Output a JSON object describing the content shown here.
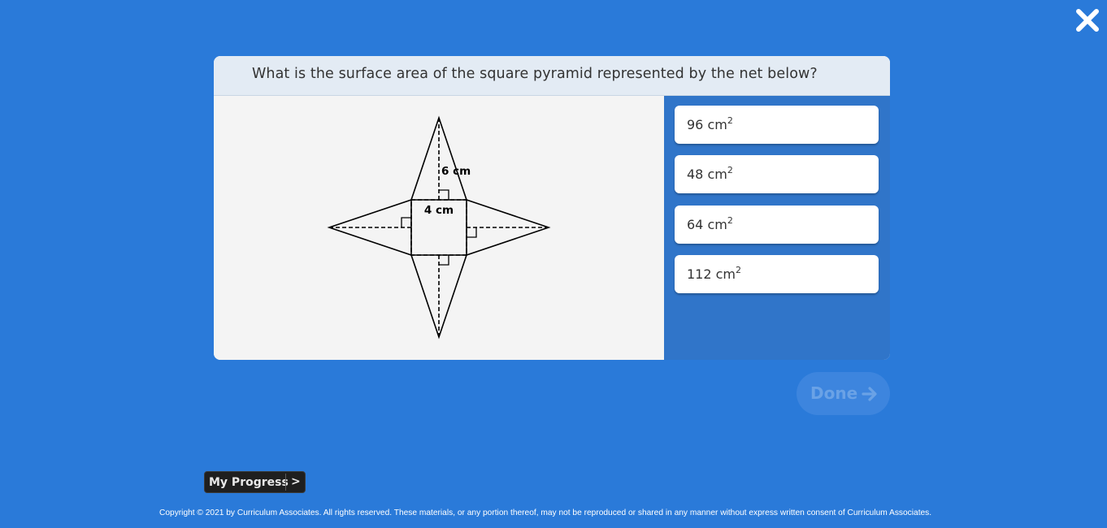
{
  "question": {
    "text": "What is the surface area of the square pyramid represented by the net below?"
  },
  "figure": {
    "label_height": "6 cm",
    "label_side": "4 cm"
  },
  "answers": [
    {
      "value": "96 cm",
      "exponent": "2"
    },
    {
      "value": "48 cm",
      "exponent": "2"
    },
    {
      "value": "64 cm",
      "exponent": "2"
    },
    {
      "value": "112 cm",
      "exponent": "2"
    }
  ],
  "done": {
    "label": "Done",
    "enabled": false
  },
  "progress": {
    "label": "My Progress",
    "chevron": ">"
  },
  "footer": {
    "copyright": "Copyright © 2021 by Curriculum Associates. All rights reserved. These materials, or any portion thereof, may not be reproduced or shared in any manner without express written consent of Curriculum Associates."
  },
  "icons": {
    "close": "close-icon",
    "done_arrow": "arrow-right-icon"
  },
  "colors": {
    "background": "#2a7ad9",
    "answers_panel": "#3075c9",
    "question_bar": "#e3ebf4"
  }
}
